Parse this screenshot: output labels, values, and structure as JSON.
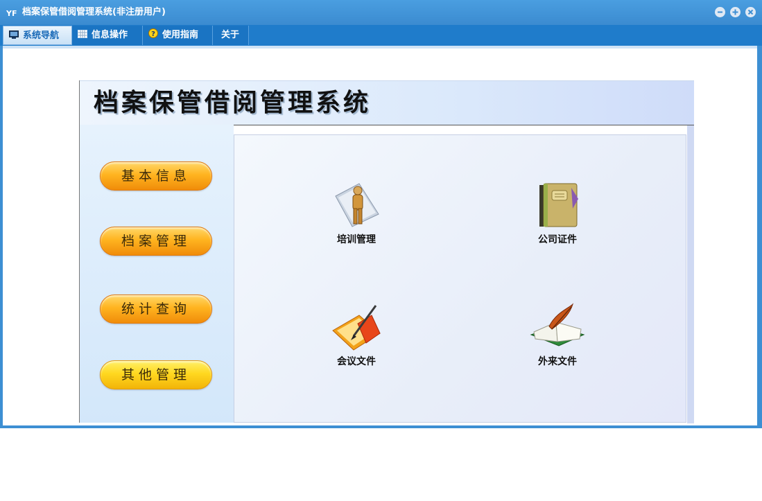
{
  "window": {
    "title": "档案保管借阅管理系统(非注册用户)",
    "app_icon": "yf-logo-icon",
    "controls": [
      "minimize-icon",
      "maximize-icon",
      "close-icon"
    ]
  },
  "tabs": [
    {
      "label": "系统导航",
      "icon": "monitor-icon",
      "active": true
    },
    {
      "label": "信息操作",
      "icon": "grid-icon",
      "active": false
    },
    {
      "label": "使用指南",
      "icon": "help-icon",
      "active": false
    },
    {
      "label": "关于",
      "icon": "",
      "active": false
    }
  ],
  "header": {
    "title": "档案保管借阅管理系统"
  },
  "sidebar": {
    "items": [
      {
        "label": "基本信息"
      },
      {
        "label": "档案管理"
      },
      {
        "label": "统计查询"
      },
      {
        "label": "其他管理"
      }
    ]
  },
  "features": [
    {
      "label": "培训管理",
      "icon": "person-folder-icon"
    },
    {
      "label": "公司证件",
      "icon": "notebook-icon"
    },
    {
      "label": "会议文件",
      "icon": "pen-folder-icon"
    },
    {
      "label": "外来文件",
      "icon": "open-book-quill-icon"
    }
  ],
  "colors": {
    "titlebar": "#3d8fd3",
    "tabbar": "#1f7ccb",
    "button_orange": "#f7a01a",
    "button_yellow": "#ffd820"
  }
}
